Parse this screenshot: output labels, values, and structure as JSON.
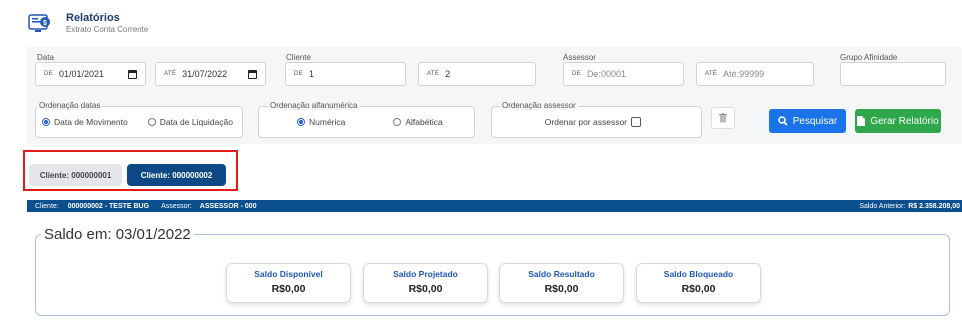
{
  "header": {
    "title": "Relatórios",
    "subtitle": "Extrato Conta Corrente",
    "icon": "report-icon"
  },
  "filters": {
    "data": {
      "label": "Data",
      "from_prefix": "DE",
      "from_value": "01/01/2021",
      "to_prefix": "ATÉ",
      "to_value": "31/07/2022"
    },
    "cliente": {
      "label": "Cliente",
      "from_prefix": "DE",
      "from_value": "1",
      "to_prefix": "ATÉ",
      "to_value": "2"
    },
    "assessor": {
      "label": "Assessor",
      "from_prefix": "DE",
      "from_placeholder": "De:00001",
      "to_prefix": "ATÉ",
      "to_placeholder": "Até:99999"
    },
    "grupo": {
      "label": "Grupo Afinidade",
      "value": ""
    }
  },
  "ordenacao_datas": {
    "legend": "Ordenação datas",
    "opt1": "Data de Movimento",
    "opt2": "Data de Liquidação",
    "selected": "Data de Movimento"
  },
  "ordenacao_alfa": {
    "legend": "Ordenação alfanumérica",
    "opt1": "Numérica",
    "opt2": "Alfabética",
    "selected": "Numérica"
  },
  "ordenacao_assessor": {
    "legend": "Ordenação assessor",
    "label": "Ordenar por assessor",
    "checked": false
  },
  "buttons": {
    "pesquisar": "Pesquisar",
    "gerar": "Gerar Relatório"
  },
  "tabs": [
    {
      "label": "Cliente: 000000001",
      "active": false
    },
    {
      "label": "Cliente: 000000002",
      "active": true
    }
  ],
  "bar": {
    "cliente_label": "Cliente:",
    "cliente_value": "000000002 - TESTE BUG",
    "assessor_label": "Assessor:",
    "assessor_value": "ASSESSOR - 000",
    "saldo_label": "Saldo Anterior:",
    "saldo_value": "R$ 2.358.208,00"
  },
  "saldo": {
    "title": "Saldo em: 03/01/2022",
    "cards": [
      {
        "title": "Saldo Disponível",
        "value": "R$0,00"
      },
      {
        "title": "Saldo Projetado",
        "value": "R$0,00"
      },
      {
        "title": "Saldo Resultado",
        "value": "R$0,00"
      },
      {
        "title": "Saldo Bloqueado",
        "value": "R$0,00"
      }
    ]
  },
  "colors": {
    "primary_blue": "#1a73e8",
    "green": "#2ea84a",
    "navy": "#0b4f8e",
    "highlight_red": "#e21b1b"
  }
}
